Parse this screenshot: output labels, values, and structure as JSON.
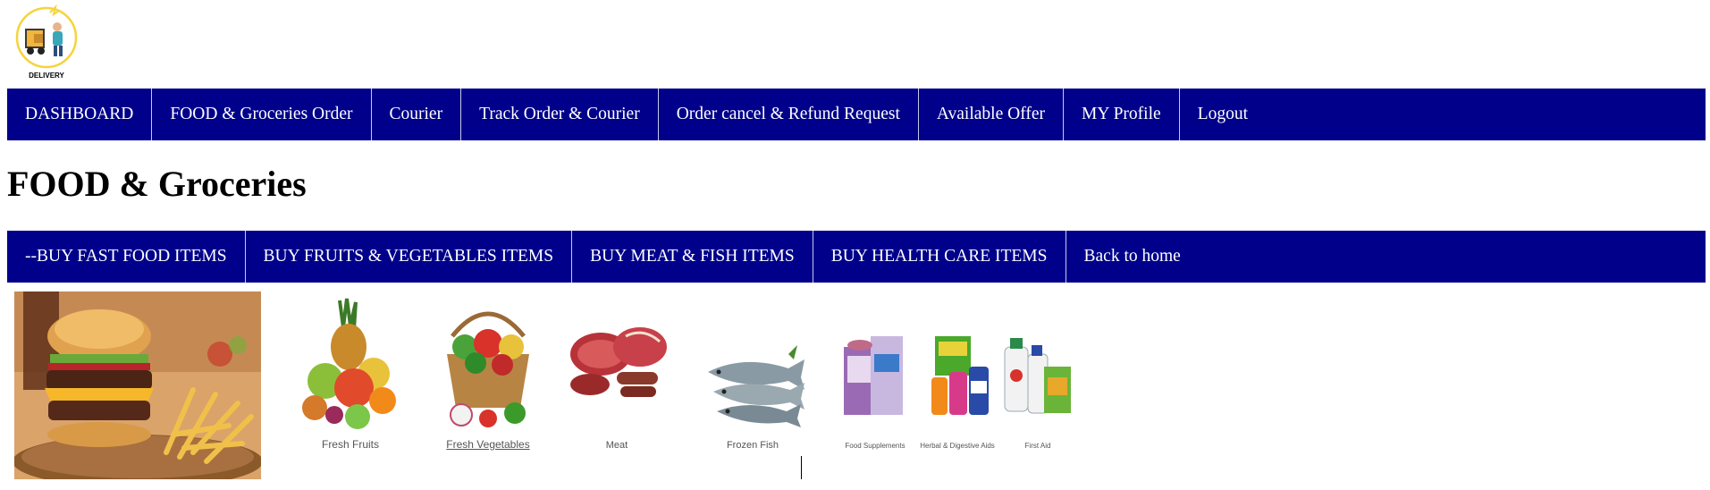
{
  "logo": {
    "label": "DELIVERY"
  },
  "main_nav": [
    {
      "label": "DASHBOARD"
    },
    {
      "label": "FOOD & Groceries Order"
    },
    {
      "label": "Courier"
    },
    {
      "label": "Track Order & Courier"
    },
    {
      "label": "Order cancel & Refund Request"
    },
    {
      "label": "Available Offer"
    },
    {
      "label": "MY Profile"
    },
    {
      "label": "Logout"
    }
  ],
  "page_title": "FOOD & Groceries",
  "sub_nav": [
    {
      "label": "--BUY FAST FOOD ITEMS"
    },
    {
      "label": "BUY FRUITS & VEGETABLES ITEMS"
    },
    {
      "label": "BUY MEAT & FISH ITEMS"
    },
    {
      "label": "BUY HEALTH CARE ITEMS"
    },
    {
      "label": "Back to home"
    }
  ],
  "products": [
    {
      "label": "Fresh Fruits"
    },
    {
      "label": "Fresh Vegetables"
    },
    {
      "label": "Meat"
    },
    {
      "label": "Frozen Fish"
    },
    {
      "label": "Food Supplements"
    },
    {
      "label": "Herbal & Digestive Aids"
    },
    {
      "label": "First Aid"
    }
  ],
  "colors": {
    "nav_background": "#00008b",
    "nav_text": "#ffffff"
  }
}
